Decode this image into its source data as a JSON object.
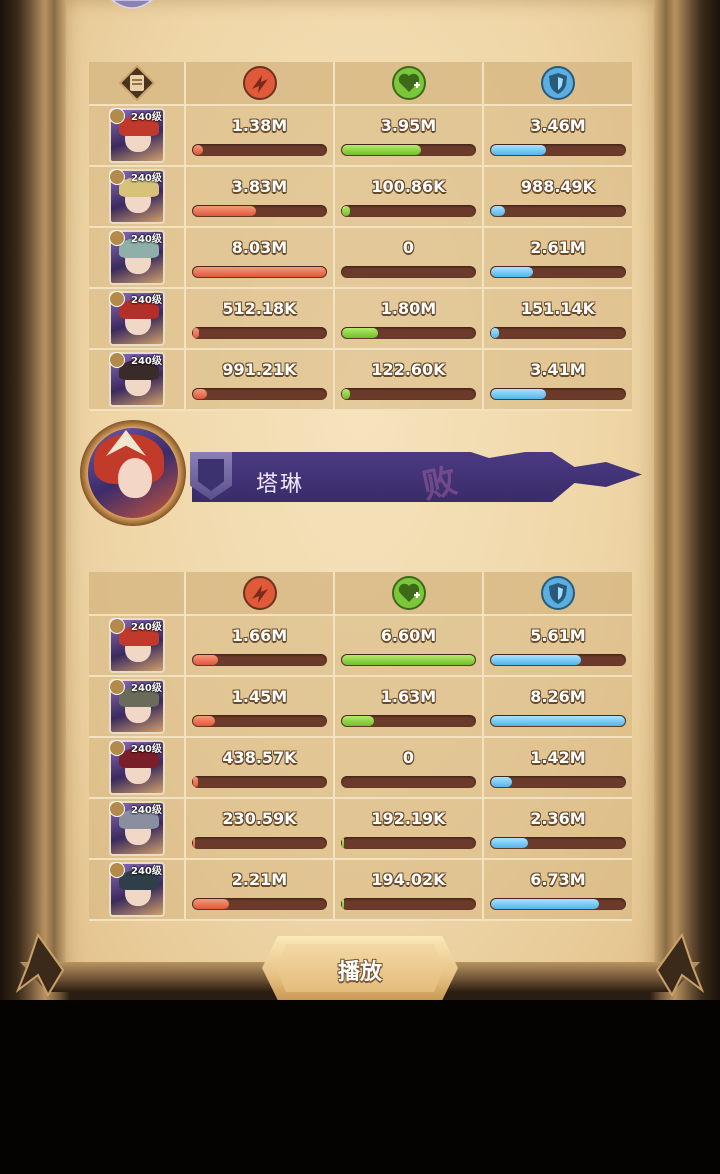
{
  "enemy_team": {
    "heroes": [
      {
        "level": "240级",
        "damage": "1.38M",
        "healing": "3.95M",
        "tanked": "3.46M",
        "damage_pct": 9,
        "healing_pct": 60,
        "tanked_pct": 42,
        "portrait_color": "#c0392b"
      },
      {
        "level": "240级",
        "damage": "3.83M",
        "healing": "100.86K",
        "tanked": "988.49K",
        "damage_pct": 48,
        "healing_pct": 2,
        "tanked_pct": 12,
        "portrait_color": "#d8c27a"
      },
      {
        "level": "240级",
        "damage": "8.03M",
        "healing": "0",
        "tanked": "2.61M",
        "damage_pct": 100,
        "healing_pct": 0,
        "tanked_pct": 32,
        "portrait_color": "#8fb0a8"
      },
      {
        "level": "240级",
        "damage": "512.18K",
        "healing": "1.80M",
        "tanked": "151.14K",
        "damage_pct": 6,
        "healing_pct": 28,
        "tanked_pct": 2,
        "portrait_color": "#b3302a"
      },
      {
        "level": "240级",
        "damage": "991.21K",
        "healing": "122.60K",
        "tanked": "3.41M",
        "damage_pct": 12,
        "healing_pct": 2,
        "tanked_pct": 42,
        "portrait_color": "#3a2a2a"
      }
    ]
  },
  "result_banner": {
    "player_name": "塔琳",
    "result_mark": "败",
    "ribbon_color": "#3f2f74"
  },
  "ally_team": {
    "heroes": [
      {
        "level": "240级",
        "damage": "1.66M",
        "healing": "6.60M",
        "tanked": "5.61M",
        "damage_pct": 20,
        "healing_pct": 100,
        "tanked_pct": 68,
        "portrait_color": "#c0392b"
      },
      {
        "level": "240级",
        "damage": "1.45M",
        "healing": "1.63M",
        "tanked": "8.26M",
        "damage_pct": 18,
        "healing_pct": 25,
        "tanked_pct": 100,
        "portrait_color": "#6b6b5a"
      },
      {
        "level": "240级",
        "damage": "438.57K",
        "healing": "0",
        "tanked": "1.42M",
        "damage_pct": 5,
        "healing_pct": 0,
        "tanked_pct": 17,
        "portrait_color": "#7a1e2a"
      },
      {
        "level": "240级",
        "damage": "230.59K",
        "healing": "192.19K",
        "tanked": "2.36M",
        "damage_pct": 3,
        "healing_pct": 3,
        "tanked_pct": 29,
        "portrait_color": "#8a8fa0"
      },
      {
        "level": "240级",
        "damage": "2.21M",
        "healing": "194.02K",
        "tanked": "6.73M",
        "damage_pct": 28,
        "healing_pct": 3,
        "tanked_pct": 81,
        "portrait_color": "#2f3e48"
      }
    ]
  },
  "stat_icons": {
    "damage": "damage-icon",
    "healing": "healing-icon",
    "tanked": "shield-icon"
  },
  "colors": {
    "damage_bar": "#e0573c",
    "healing_bar": "#6fbf2d",
    "tanked_bar": "#52b6ea"
  },
  "play_button": {
    "label": "播放"
  }
}
